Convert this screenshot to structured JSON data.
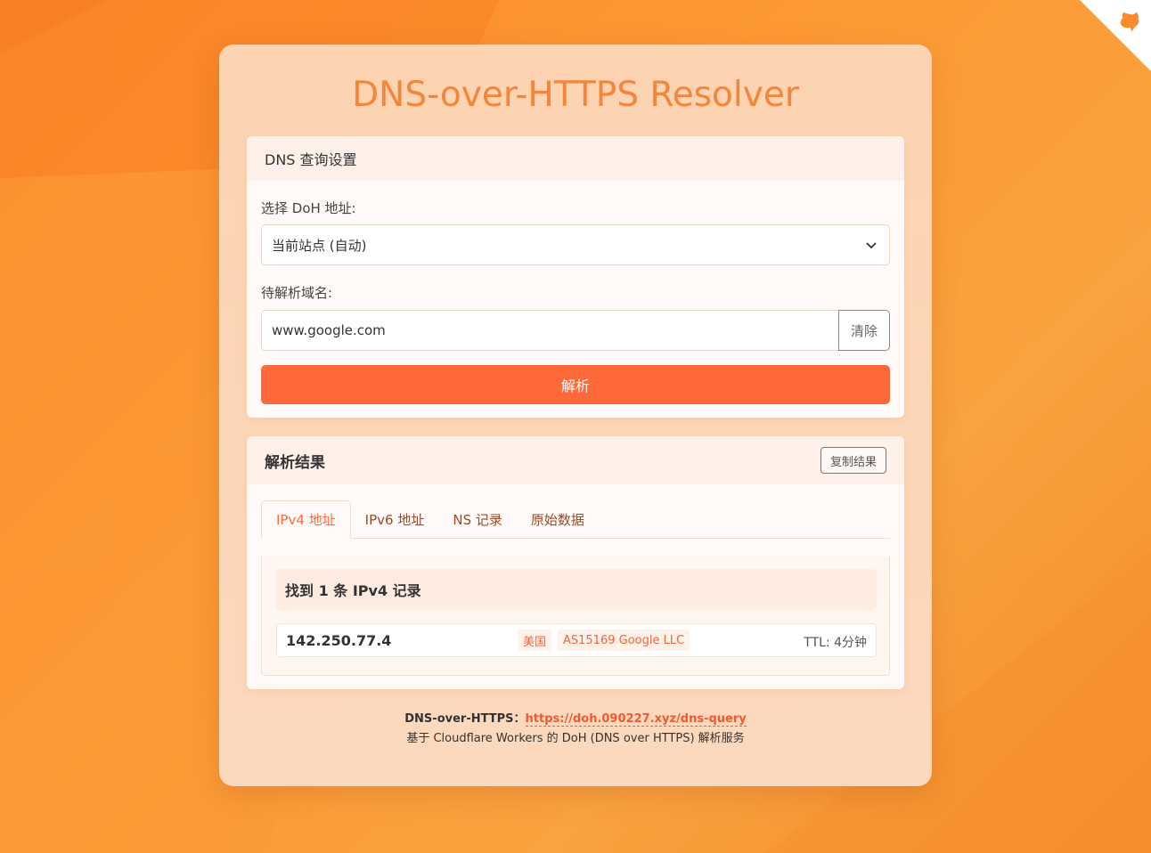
{
  "page": {
    "title": "DNS-over-HTTPS Resolver"
  },
  "query_panel": {
    "header": "DNS 查询设置",
    "doh_label": "选择 DoH 地址:",
    "doh_selected": "当前站点 (自动)",
    "domain_label": "待解析域名:",
    "domain_value": "www.google.com",
    "clear_label": "清除",
    "resolve_label": "解析"
  },
  "result_panel": {
    "header": "解析结果",
    "copy_label": "复制结果",
    "tabs": [
      {
        "label": "IPv4 地址",
        "active": true
      },
      {
        "label": "IPv6 地址",
        "active": false
      },
      {
        "label": "NS 记录",
        "active": false
      },
      {
        "label": "原始数据",
        "active": false
      }
    ],
    "summary": "找到 1 条 IPv4 记录",
    "records": [
      {
        "ip": "142.250.77.4",
        "country": "美国",
        "asn": "AS15169 Google LLC",
        "ttl": "TTL: 4分钟"
      }
    ]
  },
  "footer": {
    "doh_prefix": "DNS-over-HTTPS：",
    "doh_url": "https://doh.090227.xyz/dns-query",
    "description": "基于 Cloudflare Workers 的 DoH (DNS over HTTPS) 解析服务"
  },
  "colors": {
    "accent": "#ff683b",
    "title": "#f5853a",
    "background": "#fb8a2a"
  },
  "icons": {
    "corner": "github-icon",
    "select_arrow": "chevron-down-icon"
  }
}
